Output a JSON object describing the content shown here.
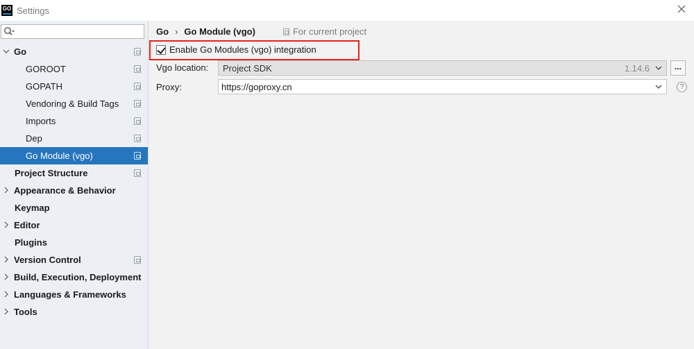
{
  "window": {
    "title": "Settings",
    "app_icon_text": "GO"
  },
  "search": {
    "placeholder": "",
    "value": ""
  },
  "sidebar": {
    "items": [
      {
        "label": "Go",
        "level": 0,
        "expanded": true,
        "bold": true,
        "project_icon": true
      },
      {
        "label": "GOROOT",
        "level": 1,
        "project_icon": true
      },
      {
        "label": "GOPATH",
        "level": 1,
        "project_icon": true
      },
      {
        "label": "Vendoring & Build Tags",
        "level": 1,
        "project_icon": true
      },
      {
        "label": "Imports",
        "level": 1,
        "project_icon": true
      },
      {
        "label": "Dep",
        "level": 1,
        "project_icon": true
      },
      {
        "label": "Go Module (vgo)",
        "level": 1,
        "selected": true,
        "project_icon": true
      },
      {
        "label": "Project Structure",
        "level": 0,
        "bold": true,
        "project_icon": true
      },
      {
        "label": "Appearance & Behavior",
        "level": 0,
        "bold": true,
        "collapsed": true
      },
      {
        "label": "Keymap",
        "level": 0,
        "bold": true
      },
      {
        "label": "Editor",
        "level": 0,
        "bold": true,
        "collapsed": true
      },
      {
        "label": "Plugins",
        "level": 0,
        "bold": true
      },
      {
        "label": "Version Control",
        "level": 0,
        "bold": true,
        "collapsed": true,
        "project_icon": true
      },
      {
        "label": "Build, Execution, Deployment",
        "level": 0,
        "bold": true,
        "collapsed": true
      },
      {
        "label": "Languages & Frameworks",
        "level": 0,
        "bold": true,
        "collapsed": true
      },
      {
        "label": "Tools",
        "level": 0,
        "bold": true,
        "collapsed": true
      }
    ]
  },
  "breadcrumb": {
    "parent": "Go",
    "separator": "›",
    "current": "Go Module (vgo)",
    "scope": "For current project"
  },
  "settings": {
    "enable_label": "Enable Go Modules (vgo) integration",
    "enable_checked": true,
    "vgo_location_label": "Vgo location:",
    "vgo_location_value": "Project SDK",
    "vgo_version": "1.14.6",
    "browse_label": "...",
    "proxy_label": "Proxy:",
    "proxy_value": "https://goproxy.cn",
    "help_label": "?"
  },
  "colors": {
    "selection": "#2675bf",
    "highlight_border": "#e8211c",
    "sidebar_bg": "#ecf0f4",
    "panel_bg": "#f2f2f2"
  }
}
